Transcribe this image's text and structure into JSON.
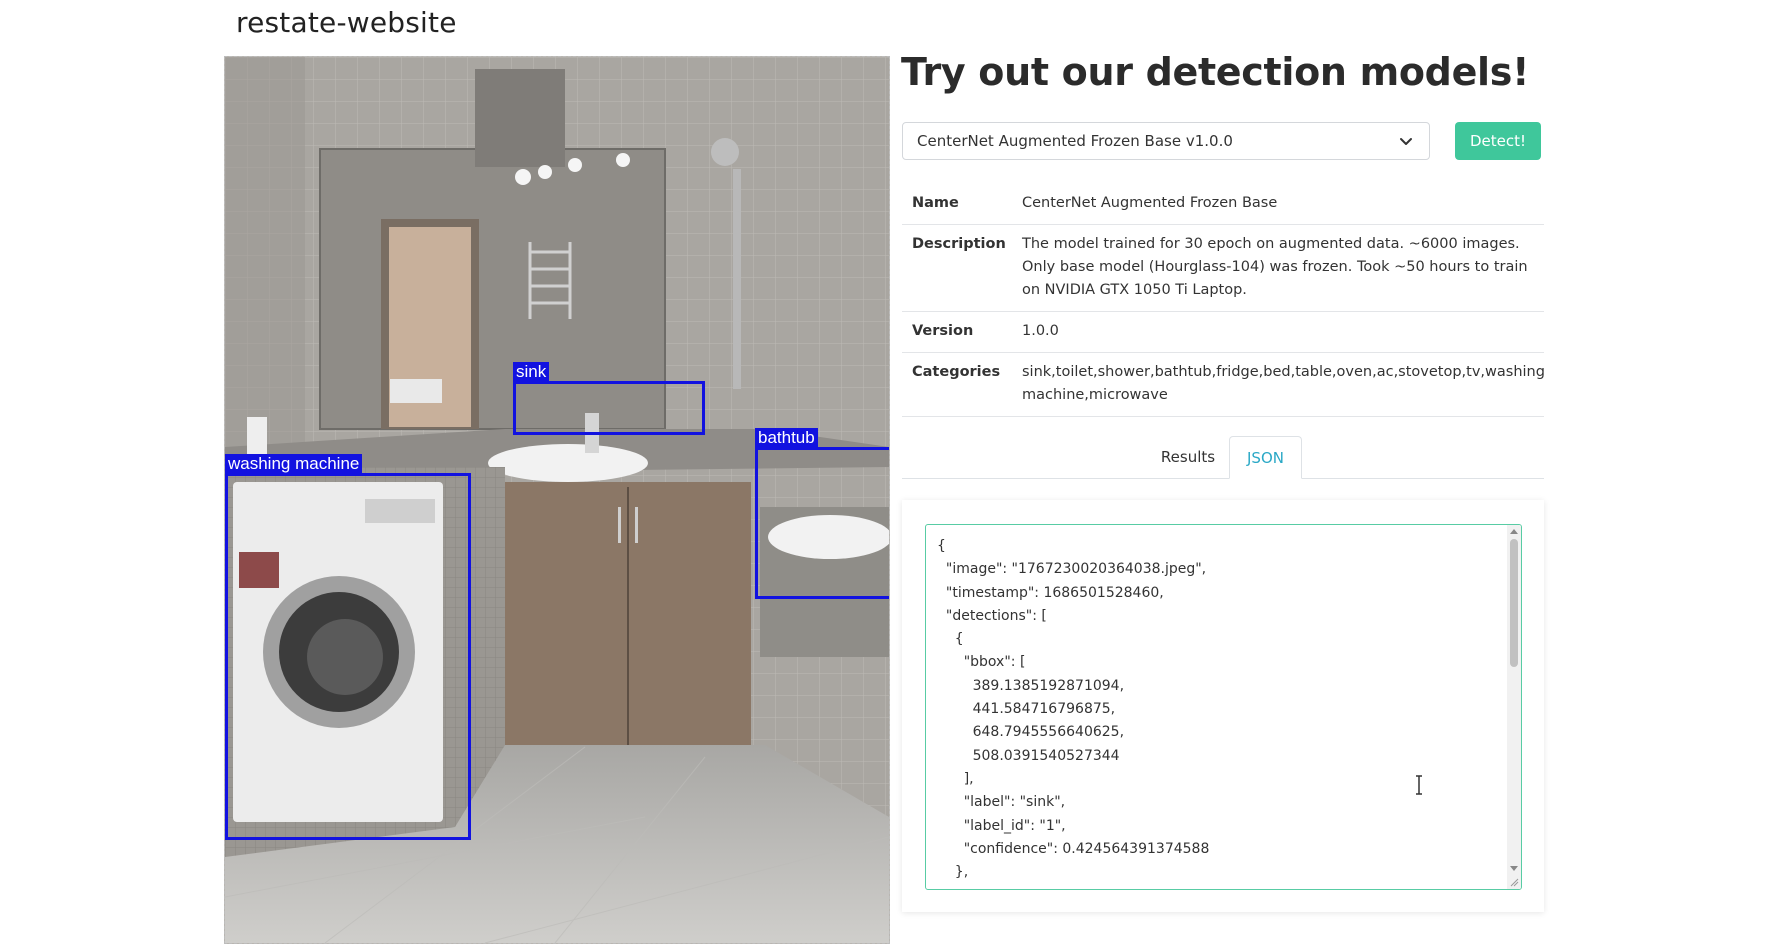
{
  "app": {
    "title": "restate-website"
  },
  "main": {
    "heading": "Try out our detection models!",
    "model_select": {
      "selected": "CenterNet Augmented Frozen Base v1.0.0"
    },
    "detect_button": "Detect!"
  },
  "info": {
    "rows": [
      {
        "key": "Name",
        "value": "CenterNet Augmented Frozen Base"
      },
      {
        "key": "Description",
        "value": "The model trained for 30 epoch on augmented data. ~6000 images. Only base model (Hourglass-104) was frozen. Took ~50 hours to train on NVIDIA GTX 1050 Ti Laptop."
      },
      {
        "key": "Version",
        "value": "1.0.0"
      },
      {
        "key": "Categories",
        "value": "sink,toilet,shower,bathtub,fridge,bed,table,oven,ac,stovetop,tv,washing machine,microwave"
      }
    ]
  },
  "tabs": {
    "results": "Results",
    "json": "JSON",
    "active": "JSON"
  },
  "json_output": {
    "lines": [
      "{",
      "  \"image\": \"1767230020364038.jpeg\",",
      "  \"timestamp\": 1686501528460,",
      "  \"detections\": [",
      "    {",
      "      \"bbox\": [",
      "        389.1385192871094,",
      "        441.584716796875,",
      "        648.7945556640625,",
      "        508.0391540527344",
      "      ],",
      "      \"label\": \"sink\",",
      "      \"label_id\": \"1\",",
      "      \"confidence\": 0.424564391374588",
      "    },"
    ]
  },
  "detections_overlay": {
    "labels": {
      "sink": "sink",
      "bathtub": "bathtub",
      "washing_machine": "washing machine"
    },
    "box_color": "#1212e0"
  },
  "colors": {
    "accent": "#3fc79b",
    "tab_active": "#2aa8c6"
  }
}
